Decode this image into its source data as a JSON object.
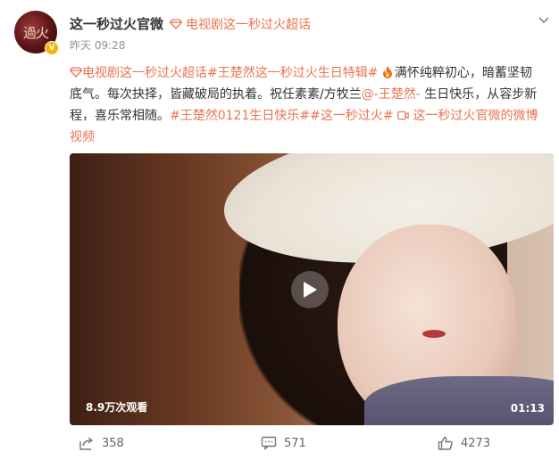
{
  "account": {
    "avatar_text": "過火",
    "name": "这一秒过火官微",
    "supertopic": "电视剧这一秒过火超话",
    "time": "昨天 09:28"
  },
  "post": {
    "tag1": "电视剧这一秒过火超话",
    "tag2": "#王楚然这一秒过火生日特辑#",
    "text1": "满怀纯粹初心，暗蓄坚韧底气。每次抉择，皆藏破局的执着。祝任素素/方牧兰",
    "mention": "@-王楚然-",
    "text2": " 生日快乐，从容步新程，喜乐常相随。",
    "tag3": "#王楚然0121生日快乐#",
    "tag4": "#这一秒过火#",
    "video_link": "这一秒过火官微的微博视频"
  },
  "video": {
    "view_count": "8.9万次观看",
    "duration": "01:13"
  },
  "actions": {
    "share": "358",
    "comment": "571",
    "like": "4273"
  },
  "colors": {
    "accent": "#eb7350",
    "text": "#333333",
    "muted": "#939393"
  }
}
